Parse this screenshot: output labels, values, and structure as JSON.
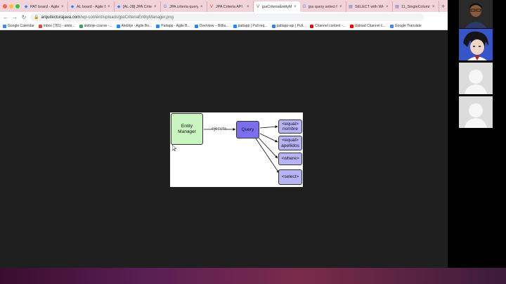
{
  "browser": {
    "tabs": [
      {
        "label": "PAT board - Agile B",
        "icon": "atlassian-icon",
        "active": false
      },
      {
        "label": "AL board - Agile Bo",
        "icon": "atlassian-icon",
        "active": false
      },
      {
        "label": "[AL-28] JPA Criteri",
        "icon": "atlassian-icon",
        "active": false
      },
      {
        "label": "JPA criteria query",
        "icon": "search-icon",
        "active": false
      },
      {
        "label": "JPA Criteria API",
        "icon": "v-icon",
        "active": false
      },
      {
        "label": "jpaCriteriaEntityMa",
        "icon": "v-icon",
        "active": true
      },
      {
        "label": "jpa query select fro",
        "icon": "search-icon",
        "active": false
      },
      {
        "label": "SELECT with WHER",
        "icon": "page-icon",
        "active": false
      },
      {
        "label": "11_SingleColumnS",
        "icon": "page-icon",
        "active": false
      }
    ],
    "url": {
      "domain": "arquitecturajava.com",
      "path": "/wp-content/uploads/jpaCriteriaEntityManager.png"
    },
    "bookmarks": [
      {
        "label": "Google Calendar",
        "color": "#4285f4"
      },
      {
        "label": "Inbox (781) - alebr...",
        "color": "#ea4335"
      },
      {
        "label": "alebrije-course -...",
        "color": "#34a853"
      },
      {
        "label": "Alebrije - Agile Bo...",
        "color": "#2684ff"
      },
      {
        "label": "Pattapp - Agile B...",
        "color": "#2684ff"
      },
      {
        "label": "Overview – Bitbu...",
        "color": "#2684ff"
      },
      {
        "label": "pattapp | Pull req...",
        "color": "#2684ff"
      },
      {
        "label": "pattapp-api | Pull...",
        "color": "#2684ff"
      },
      {
        "label": "Channel content -...",
        "color": "#ff0000"
      },
      {
        "label": "Upload Channel c...",
        "color": "#ff0000"
      },
      {
        "label": "Google Translate",
        "color": "#4285f4"
      }
    ]
  },
  "diagram": {
    "entity_manager": "Entity Manager",
    "edge_label": "ejecuta",
    "query": "Query",
    "results": [
      "<equal>\nnombre",
      "<equal>\napellidos",
      "<where>",
      "<select>"
    ]
  },
  "colors": {
    "tabbar": "#f2d3da",
    "entity_manager_fill": "#c8f5c0",
    "query_fill": "#7b6ff0",
    "result_fill": "#b7b3f7"
  }
}
